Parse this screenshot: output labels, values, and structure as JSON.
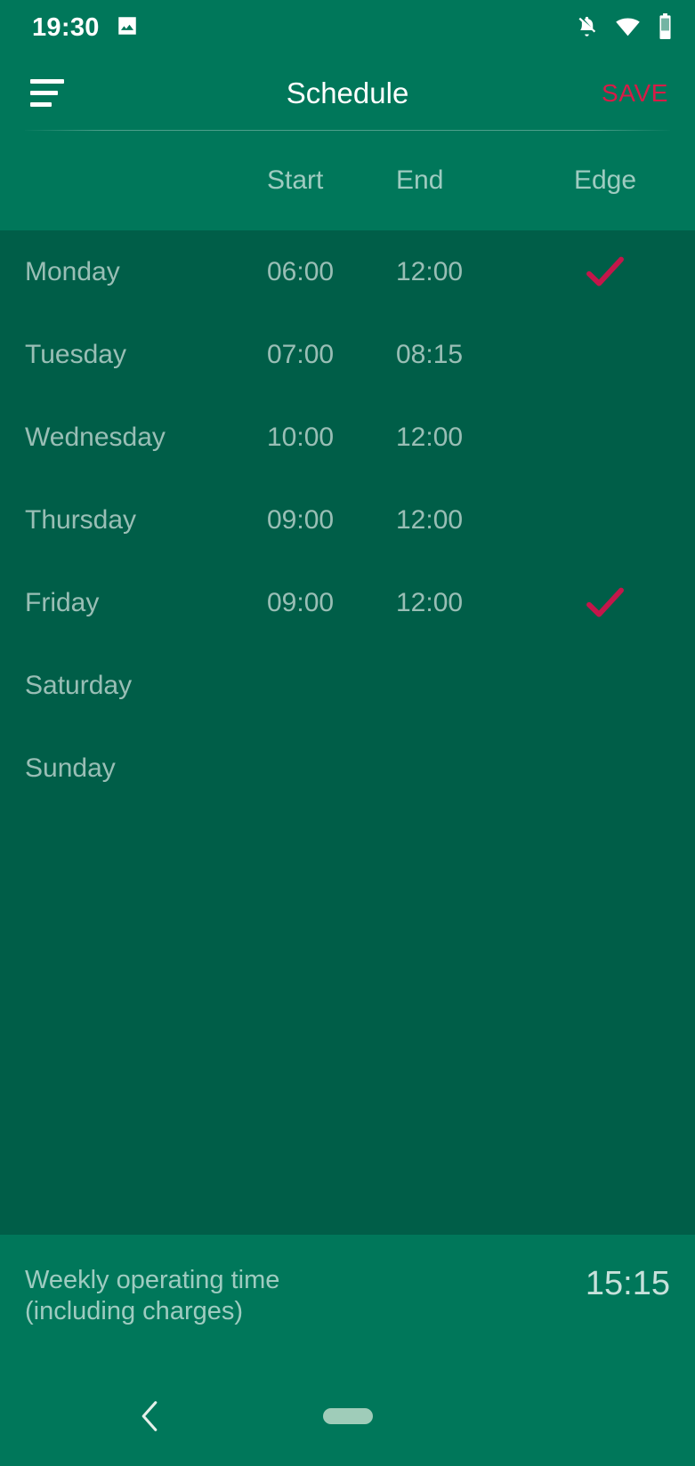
{
  "colors": {
    "app_bar_green": "#00775a",
    "list_green": "#005e48",
    "accent_red": "#d81b47",
    "check_red": "#c4164a",
    "home_pill": "#9fccb9"
  },
  "status_bar": {
    "clock": "19:30",
    "icons": {
      "photo": "image-icon",
      "notifications_off": "bell-off-icon",
      "wifi": "wifi-icon",
      "battery": "battery-icon"
    }
  },
  "app_bar": {
    "menu_label": "menu-icon",
    "title": "Schedule",
    "save_label": "SAVE"
  },
  "table": {
    "headers": {
      "day": "",
      "start": "Start",
      "end": "End",
      "edge": "Edge"
    },
    "rows": [
      {
        "day": "Monday",
        "start": "06:00",
        "end": "12:00",
        "edge": true
      },
      {
        "day": "Tuesday",
        "start": "07:00",
        "end": "08:15",
        "edge": false
      },
      {
        "day": "Wednesday",
        "start": "10:00",
        "end": "12:00",
        "edge": false
      },
      {
        "day": "Thursday",
        "start": "09:00",
        "end": "12:00",
        "edge": false
      },
      {
        "day": "Friday",
        "start": "09:00",
        "end": "12:00",
        "edge": true
      },
      {
        "day": "Saturday",
        "start": "",
        "end": "",
        "edge": false
      },
      {
        "day": "Sunday",
        "start": "",
        "end": "",
        "edge": false
      }
    ]
  },
  "footer": {
    "label_line1": "Weekly operating time",
    "label_line2": "(including charges)",
    "value": "15:15"
  },
  "nav_bar": {
    "back_label": "back-icon",
    "home_label": "home-indicator"
  }
}
